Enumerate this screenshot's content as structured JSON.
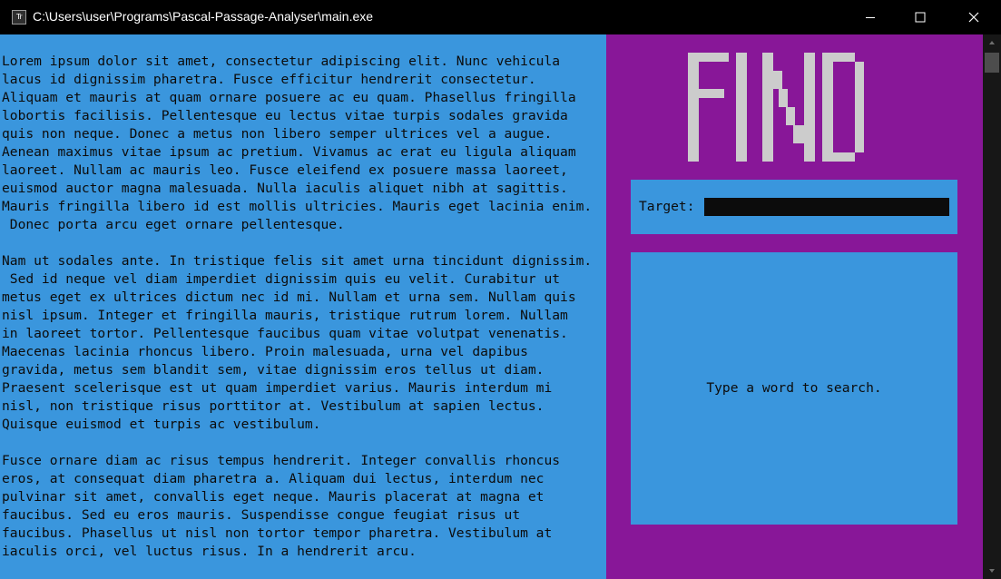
{
  "window": {
    "title": "C:\\Users\\user\\Programs\\Pascal-Passage-Analyser\\main.exe",
    "icon": "terminal-app-icon",
    "icon_glyph": "Tr"
  },
  "passage": {
    "paragraphs": [
      "Lorem ipsum dolor sit amet, consectetur adipiscing elit. Nunc vehicula\nlacus id dignissim pharetra. Fusce efficitur hendrerit consectetur.\nAliquam et mauris at quam ornare posuere ac eu quam. Phasellus fringilla\nlobortis facilisis. Pellentesque eu lectus vitae turpis sodales gravida\nquis non neque. Donec a metus non libero semper ultrices vel a augue.\nAenean maximus vitae ipsum ac pretium. Vivamus ac erat eu ligula aliquam\nlaoreet. Nullam ac mauris leo. Fusce eleifend ex posuere massa laoreet,\neuismod auctor magna malesuada. Nulla iaculis aliquet nibh at sagittis.\nMauris fringilla libero id est mollis ultricies. Mauris eget lacinia enim.\n Donec porta arcu eget ornare pellentesque.",
      "Nam ut sodales ante. In tristique felis sit amet urna tincidunt dignissim.\n Sed id neque vel diam imperdiet dignissim quis eu velit. Curabitur ut\nmetus eget ex ultrices dictum nec id mi. Nullam et urna sem. Nullam quis\nnisl ipsum. Integer et fringilla mauris, tristique rutrum lorem. Nullam\nin laoreet tortor. Pellentesque faucibus quam vitae volutpat venenatis.\nMaecenas lacinia rhoncus libero. Proin malesuada, urna vel dapibus\ngravida, metus sem blandit sem, vitae dignissim eros tellus ut diam.\nPraesent scelerisque est ut quam imperdiet varius. Mauris interdum mi\nnisl, non tristique risus porttitor at. Vestibulum at sapien lectus.\nQuisque euismod et turpis ac vestibulum.",
      "Fusce ornare diam ac risus tempus hendrerit. Integer convallis rhoncus\neros, at consequat diam pharetra a. Aliquam dui lectus, interdum nec\npulvinar sit amet, convallis eget neque. Mauris placerat at magna et\nfaucibus. Sed eu eros mauris. Suspendisse congue feugiat risus ut\nfaucibus. Phasellus ut nisl non tortor tempor pharetra. Vestibulum at\niaculis orci, vel luctus risus. In a hendrerit arcu."
    ]
  },
  "side": {
    "logo_text": "FIND",
    "target_label": "Target:",
    "target_value": "",
    "result_message": "Type a word to search."
  },
  "colors": {
    "passage_bg": "#3a96dd",
    "panel_bg": "#881798",
    "text": "#0c0c0c",
    "logo": "#cccccc",
    "input_bg": "#0c0c0c",
    "titlebar_bg": "#000000"
  }
}
